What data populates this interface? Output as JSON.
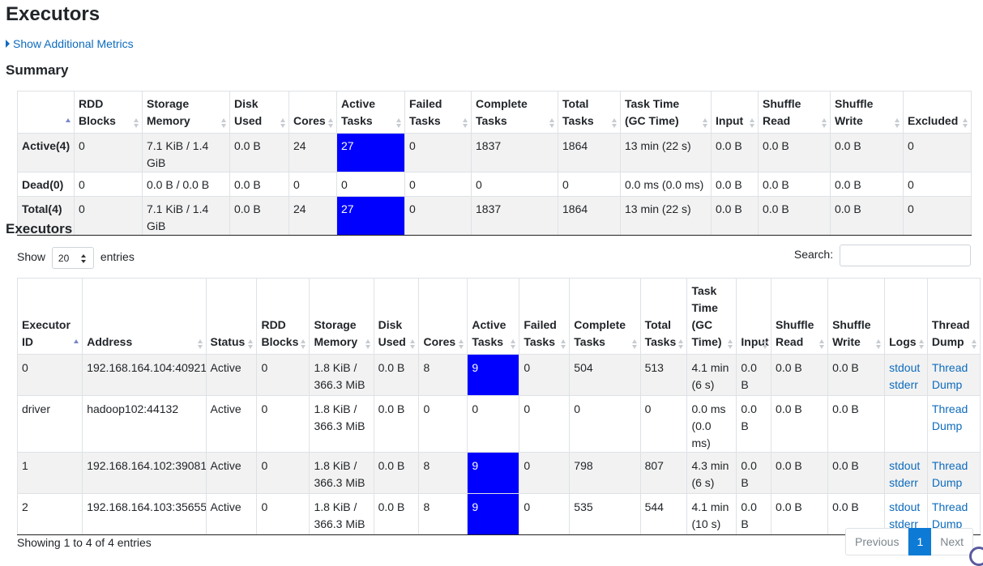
{
  "page": {
    "title": "Executors",
    "metrics_link": "Show Additional Metrics"
  },
  "summary": {
    "title": "Summary",
    "headers": [
      "",
      "RDD Blocks",
      "Storage Memory",
      "Disk Used",
      "Cores",
      "Active Tasks",
      "Failed Tasks",
      "Complete Tasks",
      "Total Tasks",
      "Task Time (GC Time)",
      "Input",
      "Shuffle Read",
      "Shuffle Write",
      "Excluded"
    ],
    "rows": [
      [
        "Active(4)",
        "0",
        "7.1 KiB / 1.4 GiB",
        "0.0 B",
        "24",
        "27",
        "0",
        "1837",
        "1864",
        "13 min (22 s)",
        "0.0 B",
        "0.0 B",
        "0.0 B",
        "0"
      ],
      [
        "Dead(0)",
        "0",
        "0.0 B / 0.0 B",
        "0.0 B",
        "0",
        "0",
        "0",
        "0",
        "0",
        "0.0 ms (0.0 ms)",
        "0.0 B",
        "0.0 B",
        "0.0 B",
        "0"
      ],
      [
        "Total(4)",
        "0",
        "7.1 KiB / 1.4 GiB",
        "0.0 B",
        "24",
        "27",
        "0",
        "1837",
        "1864",
        "13 min (22 s)",
        "0.0 B",
        "0.0 B",
        "0.0 B",
        "0"
      ]
    ]
  },
  "executors": {
    "title": "Executors",
    "show_label": "Show",
    "entries_label": "entries",
    "page_size": "20",
    "search_label": "Search:",
    "headers": [
      "Executor ID",
      "Address",
      "Status",
      "RDD Blocks",
      "Storage Memory",
      "Disk Used",
      "Cores",
      "Active Tasks",
      "Failed Tasks",
      "Complete Tasks",
      "Total Tasks",
      "Task Time (GC Time)",
      "Input",
      "Shuffle Read",
      "Shuffle Write",
      "Logs",
      "Thread Dump"
    ],
    "rows": [
      {
        "id": "0",
        "address": "192.168.164.104:40921",
        "status": "Active",
        "rdd_blocks": "0",
        "storage_memory": "1.8 KiB / 366.3 MiB",
        "disk_used": "0.0 B",
        "cores": "8",
        "active_tasks": "9",
        "failed_tasks": "0",
        "complete_tasks": "504",
        "total_tasks": "513",
        "task_time": "4.1 min (6 s)",
        "input": "0.0 B",
        "shuffle_read": "0.0 B",
        "shuffle_write": "0.0 B",
        "logs": [
          "stdout",
          "stderr"
        ],
        "thread_dump": "Thread Dump"
      },
      {
        "id": "driver",
        "address": "hadoop102:44132",
        "status": "Active",
        "rdd_blocks": "0",
        "storage_memory": "1.8 KiB / 366.3 MiB",
        "disk_used": "0.0 B",
        "cores": "0",
        "active_tasks": "0",
        "failed_tasks": "0",
        "complete_tasks": "0",
        "total_tasks": "0",
        "task_time": "0.0 ms (0.0 ms)",
        "input": "0.0 B",
        "shuffle_read": "0.0 B",
        "shuffle_write": "0.0 B",
        "logs": [],
        "thread_dump": "Thread Dump"
      },
      {
        "id": "1",
        "address": "192.168.164.102:39081",
        "status": "Active",
        "rdd_blocks": "0",
        "storage_memory": "1.8 KiB / 366.3 MiB",
        "disk_used": "0.0 B",
        "cores": "8",
        "active_tasks": "9",
        "failed_tasks": "0",
        "complete_tasks": "798",
        "total_tasks": "807",
        "task_time": "4.3 min (6 s)",
        "input": "0.0 B",
        "shuffle_read": "0.0 B",
        "shuffle_write": "0.0 B",
        "logs": [
          "stdout",
          "stderr"
        ],
        "thread_dump": "Thread Dump"
      },
      {
        "id": "2",
        "address": "192.168.164.103:35655",
        "status": "Active",
        "rdd_blocks": "0",
        "storage_memory": "1.8 KiB / 366.3 MiB",
        "disk_used": "0.0 B",
        "cores": "8",
        "active_tasks": "9",
        "failed_tasks": "0",
        "complete_tasks": "535",
        "total_tasks": "544",
        "task_time": "4.1 min (10 s)",
        "input": "0.0 B",
        "shuffle_read": "0.0 B",
        "shuffle_write": "0.0 B",
        "logs": [
          "stdout",
          "stderr"
        ],
        "thread_dump": "Thread Dump"
      }
    ],
    "info": "Showing 1 to 4 of 4 entries",
    "pagination": {
      "previous": "Previous",
      "current": "1",
      "next": "Next"
    }
  },
  "colors": {
    "highlight": "#0000ff",
    "link": "#0d6bbd",
    "page_active": "#0d7bd6",
    "row_stripe": "#f2f2f2"
  }
}
